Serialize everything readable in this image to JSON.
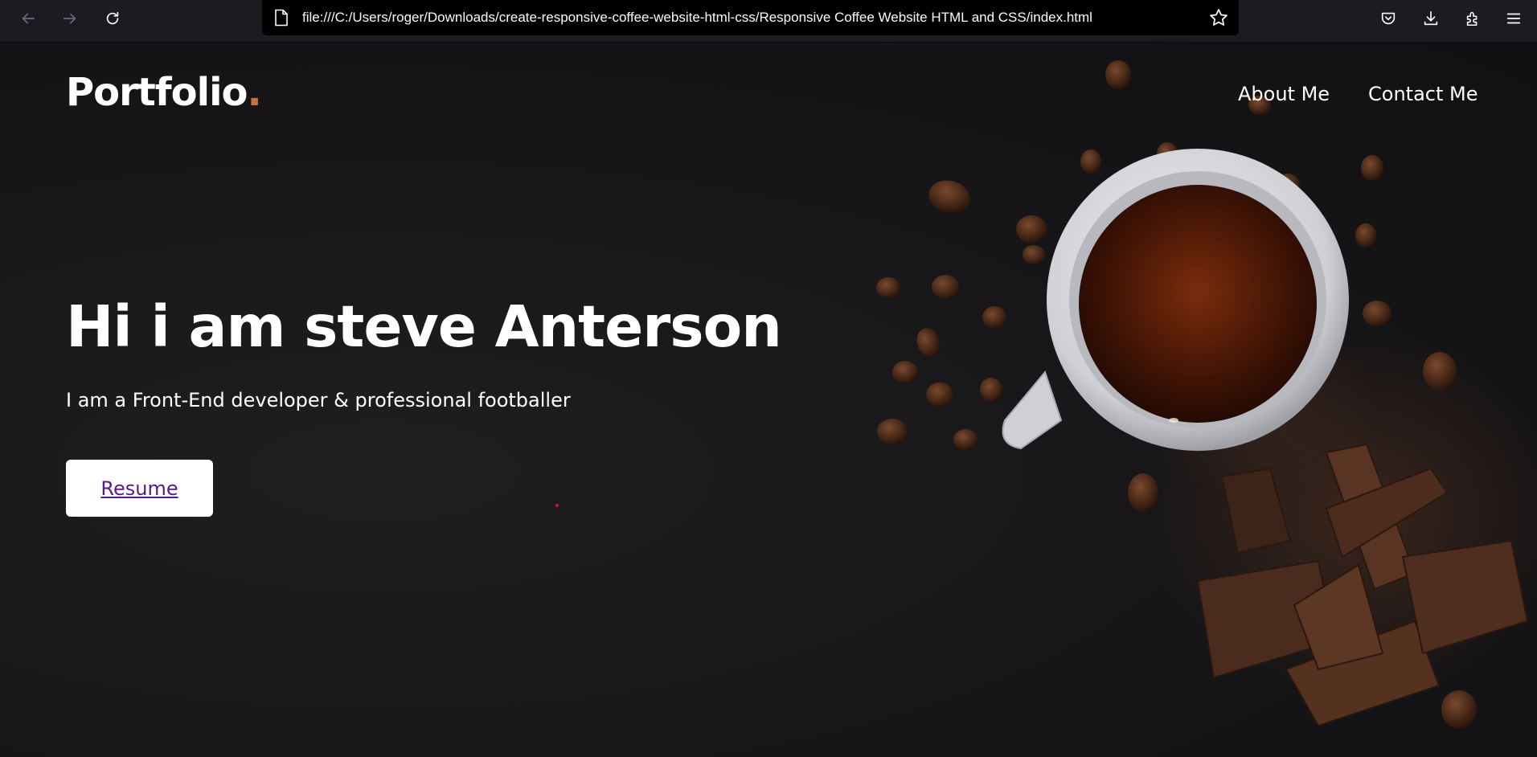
{
  "browser": {
    "url": "file:///C:/Users/roger/Downloads/create-responsive-coffee-website-html-css/Responsive Coffee Website HTML and CSS/index.html",
    "icons": {
      "back": "back-arrow-icon",
      "forward": "forward-arrow-icon",
      "reload": "reload-icon",
      "page": "page-icon",
      "bookmark": "star-icon",
      "pocket": "pocket-icon",
      "downloads": "download-icon",
      "extensions": "extensions-icon",
      "menu": "hamburger-menu-icon"
    }
  },
  "site": {
    "logo_text": "Portfolio",
    "logo_dot": ".",
    "nav": [
      {
        "label": "About Me"
      },
      {
        "label": "Contact Me"
      }
    ],
    "hero": {
      "title": "Hi i am steve Anterson",
      "subtitle": "I am a Front-End developer & professional footballer",
      "button_label": "Resume"
    }
  },
  "colors": {
    "background": "#141315",
    "accent_dot": "#c7733b",
    "link_visited": "#551a8b",
    "button_bg": "#ffffff"
  }
}
